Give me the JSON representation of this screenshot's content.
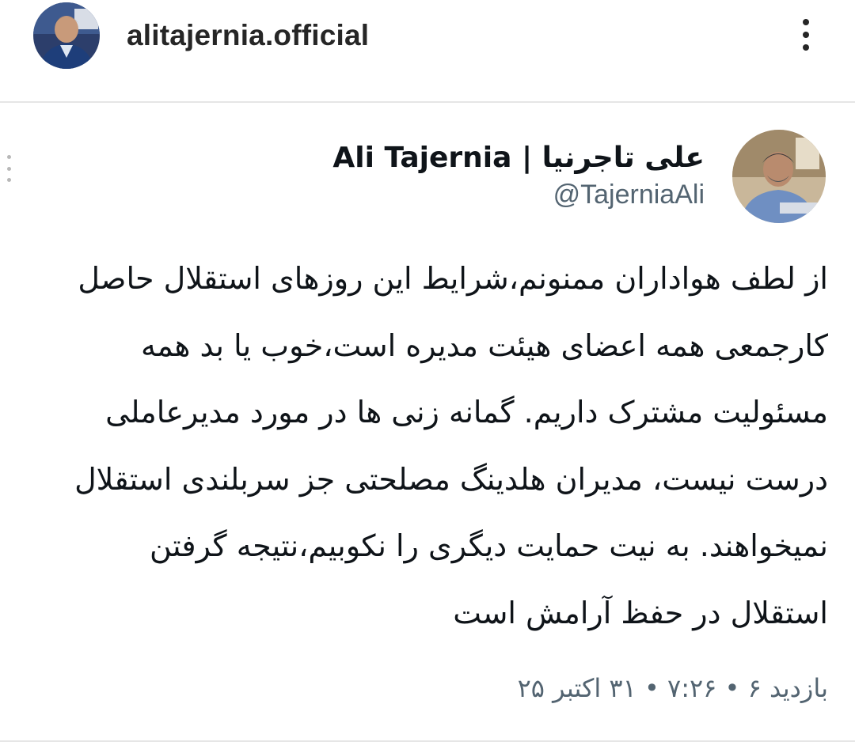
{
  "header": {
    "username": "alitajernia.official",
    "avatar_icon": "profile-photo-icon",
    "more_icon": "vertical-ellipsis-icon"
  },
  "tweet": {
    "display_name": "علی تاجرنیا | Ali Tajernia",
    "handle": "@TajerniaAli",
    "avatar_icon": "profile-photo-icon",
    "body_lines": [
      "از لطف هواداران ممنونم،شرایط این روزهای استقلال حاصل",
      "کارجمعی همه اعضای هیئت مدیره است،خوب یا بد همه",
      "مسئولیت مشترک داریم. گمانه زنی ها در مورد مدیرعاملی",
      "درست نیست، مدیران هلدینگ مصلحتی جز سربلندی استقلال",
      "نمیخواهند. به نیت حمایت دیگری را نکوبیم،نتیجه گرفتن",
      "استقلال در حفظ آرامش است"
    ],
    "meta": "بازدید ۶ • ۷:۲۶ • ۳۱ اکتبر ۲۵"
  },
  "colors": {
    "text_primary": "#0f1419",
    "text_secondary": "#536471",
    "divider": "#e6e6e6"
  }
}
